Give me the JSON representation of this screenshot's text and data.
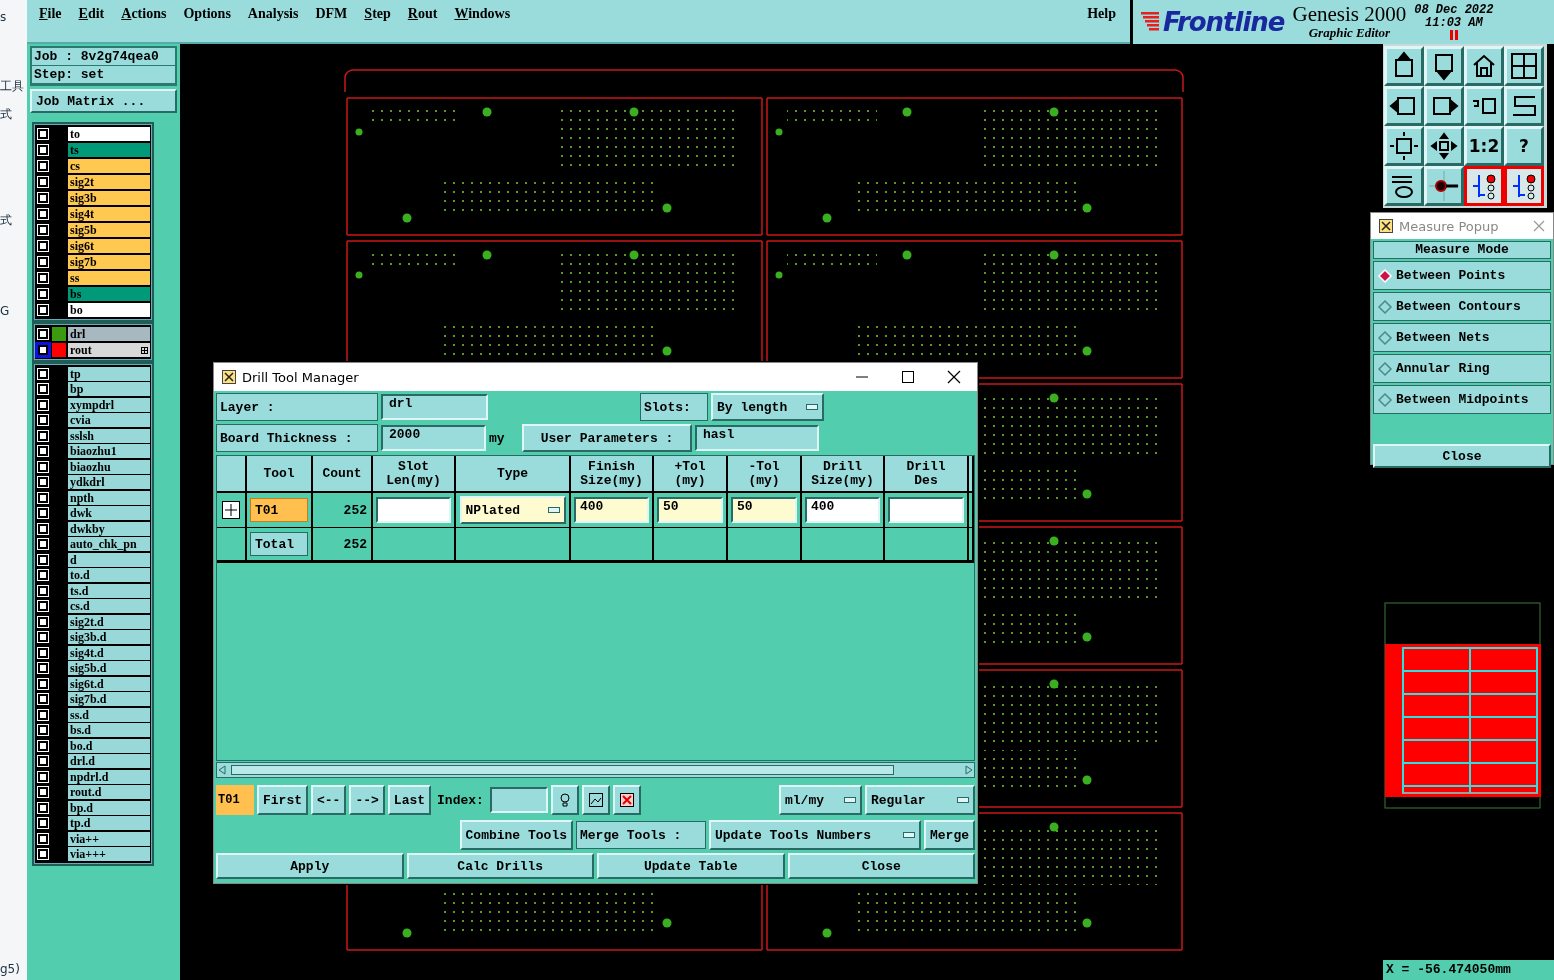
{
  "background_window": {
    "fragments": [
      "s",
      "工具",
      "式",
      "式",
      "G",
      "g5)"
    ]
  },
  "menu": [
    {
      "label": "File",
      "mnemonic": true
    },
    {
      "label": "Edit",
      "mnemonic": true
    },
    {
      "label": "Actions",
      "mnemonic": true
    },
    {
      "label": "Options",
      "mnemonic": false
    },
    {
      "label": "Analysis",
      "mnemonic": false
    },
    {
      "label": "DFM",
      "mnemonic": false
    },
    {
      "label": "Step",
      "mnemonic": true
    },
    {
      "label": "Rout",
      "mnemonic": true
    },
    {
      "label": "Windows",
      "mnemonic": true
    }
  ],
  "help": "Help",
  "brand": {
    "logo": "Frontline",
    "product": "Genesis 2000",
    "subtitle": "Graphic Editor",
    "date": "08 Dec 2022",
    "time": "11:03 AM"
  },
  "job": {
    "job": "Job : 8v2g74qea0",
    "step": "Step: set",
    "matrix_button": "Job Matrix ..."
  },
  "layers": {
    "board": [
      {
        "name": "to",
        "color": "#ffffff",
        "checked": false
      },
      {
        "name": "ts",
        "color": "#009a78",
        "checked": false
      },
      {
        "name": "cs",
        "color": "#ffc850",
        "checked": false
      },
      {
        "name": "sig2t",
        "color": "#ffc850",
        "checked": false
      },
      {
        "name": "sig3b",
        "color": "#ffc850",
        "checked": false
      },
      {
        "name": "sig4t",
        "color": "#ffc850",
        "checked": false
      },
      {
        "name": "sig5b",
        "color": "#ffc850",
        "checked": false
      },
      {
        "name": "sig6t",
        "color": "#ffc850",
        "checked": false
      },
      {
        "name": "sig7b",
        "color": "#ffc850",
        "checked": false
      },
      {
        "name": "ss",
        "color": "#ffc850",
        "checked": false
      },
      {
        "name": "bs",
        "color": "#009a78",
        "checked": false
      },
      {
        "name": "bo",
        "color": "#ffffff",
        "checked": false
      }
    ],
    "drill": [
      {
        "name": "drl",
        "color": "#3c9a10",
        "checked": false,
        "selected": false,
        "expandable": false
      },
      {
        "name": "rout",
        "color": "#ff0000",
        "checked": false,
        "selected": true,
        "expandable": true
      }
    ],
    "misc": [
      {
        "name": "tp",
        "checked": false
      },
      {
        "name": "bp",
        "checked": false
      },
      {
        "name": "xympdrl",
        "checked": false
      },
      {
        "name": "cvia",
        "checked": false
      },
      {
        "name": "sslsh",
        "checked": false
      },
      {
        "name": "biaozhu1",
        "checked": false
      },
      {
        "name": "biaozhu",
        "checked": false
      },
      {
        "name": "ydkdrl",
        "checked": false
      },
      {
        "name": "npth",
        "checked": false
      },
      {
        "name": "dwk",
        "checked": false
      },
      {
        "name": "dwkby",
        "checked": false
      },
      {
        "name": "auto_chk_pn",
        "checked": false
      },
      {
        "name": "d",
        "checked": false
      },
      {
        "name": "to.d",
        "checked": false
      },
      {
        "name": "ts.d",
        "checked": false
      },
      {
        "name": "cs.d",
        "checked": false
      },
      {
        "name": "sig2t.d",
        "checked": false
      },
      {
        "name": "sig3b.d",
        "checked": false
      },
      {
        "name": "sig4t.d",
        "checked": false
      },
      {
        "name": "sig5b.d",
        "checked": false
      },
      {
        "name": "sig6t.d",
        "checked": false
      },
      {
        "name": "sig7b.d",
        "checked": false
      },
      {
        "name": "ss.d",
        "checked": false
      },
      {
        "name": "bs.d",
        "checked": false
      },
      {
        "name": "bo.d",
        "checked": false
      },
      {
        "name": "drl.d",
        "checked": false
      },
      {
        "name": "npdrl.d",
        "checked": false
      },
      {
        "name": "rout.d",
        "checked": false
      },
      {
        "name": "bp.d",
        "checked": false
      },
      {
        "name": "tp.d",
        "checked": false
      },
      {
        "name": "via++",
        "checked": false
      },
      {
        "name": "via+++",
        "checked": false
      }
    ]
  },
  "toolbar": [
    {
      "kind": "up"
    },
    {
      "kind": "down"
    },
    {
      "kind": "home"
    },
    {
      "kind": "grid"
    },
    {
      "kind": "left"
    },
    {
      "kind": "right"
    },
    {
      "kind": "undo"
    },
    {
      "kind": "zigzag"
    },
    {
      "kind": "fit"
    },
    {
      "kind": "pan"
    },
    {
      "kind": "ratio",
      "label": "1:2"
    },
    {
      "kind": "help",
      "label": "?"
    },
    {
      "kind": "tools"
    },
    {
      "kind": "probe"
    },
    {
      "kind": "net"
    },
    {
      "kind": "net"
    }
  ],
  "measure_popup": {
    "title": "Measure Popup",
    "heading": "Measure Mode",
    "options": [
      {
        "label": "Between Points",
        "selected": true
      },
      {
        "label": "Between Contours",
        "selected": false
      },
      {
        "label": "Between Nets",
        "selected": false
      },
      {
        "label": "Annular Ring",
        "selected": false
      },
      {
        "label": "Between Midpoints",
        "selected": false
      }
    ],
    "close": "Close"
  },
  "coordinate": "X = -56.474050mm",
  "drill_tool_manager": {
    "title": "Drill Tool Manager",
    "layer_label": "Layer :",
    "layer": "drl",
    "slots_label": "Slots:",
    "slots": "By length",
    "thickness_label": "Board Thickness :",
    "thickness": "2000",
    "thickness_unit": "my",
    "user_params_button": "User Parameters :",
    "user_params": "hasl",
    "table": {
      "columns": [
        "Tool",
        "Count",
        "Slot\nLen(my)",
        "Type",
        "Finish\nSize(my)",
        "+Tol\n(my)",
        "-Tol\n(my)",
        "Drill\nSize(my)",
        "Drill\nDes"
      ],
      "rows": [
        {
          "kind": "tool",
          "tool": "T01",
          "count": "252",
          "type": "NPlated",
          "finish": "400",
          "plus_tol": "50",
          "minus_tol": "50",
          "drill_size": "400"
        },
        {
          "kind": "total",
          "tool": "Total",
          "count": "252"
        }
      ]
    },
    "current_tool": "T01",
    "nav": [
      "First",
      "<--",
      "-->",
      "Last"
    ],
    "index_label": "Index:",
    "units": "ml/my",
    "mode": "Regular",
    "combine": "Combine Tools",
    "merge_label": "Merge Tools :",
    "update_numbers": "Update Tools Numbers",
    "merge": "Merge",
    "actions": [
      "Apply",
      "Calc Drills",
      "Update Table",
      "Close"
    ]
  }
}
